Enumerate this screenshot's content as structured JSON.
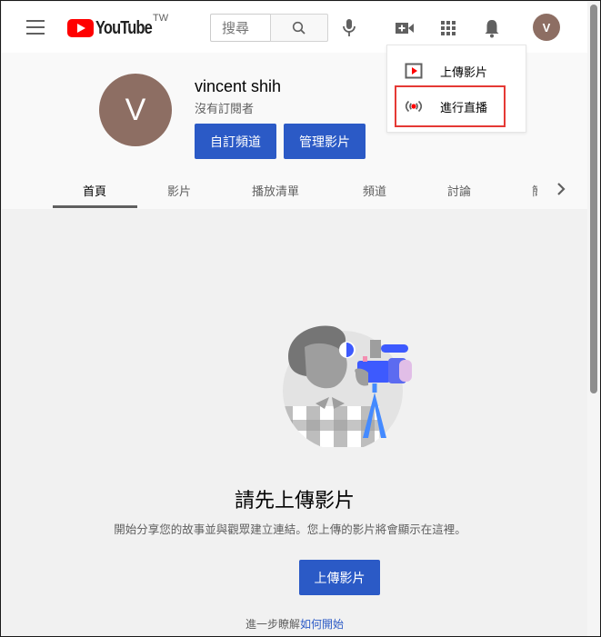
{
  "header": {
    "logo_text": "YouTube",
    "country_code": "TW",
    "search": {
      "placeholder": "搜尋",
      "value": ""
    },
    "icons": [
      "menu-icon",
      "search-icon",
      "microphone-icon",
      "create-video-icon",
      "apps-grid-icon",
      "notifications-bell-icon"
    ],
    "account_initial": "V"
  },
  "create_menu": {
    "items": [
      {
        "label": "上傳影片",
        "icon": "upload-video-icon"
      },
      {
        "label": "進行直播",
        "icon": "go-live-icon",
        "highlighted": true
      }
    ],
    "highlight_color": "#e53935"
  },
  "channel": {
    "initial": "V",
    "name": "vincent shih",
    "subscribers": "沒有訂閱者",
    "customize_label": "自訂頻道",
    "manage_label": "管理影片",
    "avatar_color": "#8d6e63",
    "button_color": "#2b5ac6"
  },
  "tabs": [
    {
      "label": "首頁",
      "active": true
    },
    {
      "label": "影片"
    },
    {
      "label": "播放清單"
    },
    {
      "label": "頻道"
    },
    {
      "label": "討論"
    },
    {
      "label": "簡"
    }
  ],
  "empty_state": {
    "title": "請先上傳影片",
    "description": "開始分享您的故事並與觀眾建立連結。您上傳的影片將會顯示在這裡。",
    "upload_label": "上傳影片",
    "learn_more_prefix": "進一步瞭解",
    "learn_more_link": "如何開始"
  }
}
